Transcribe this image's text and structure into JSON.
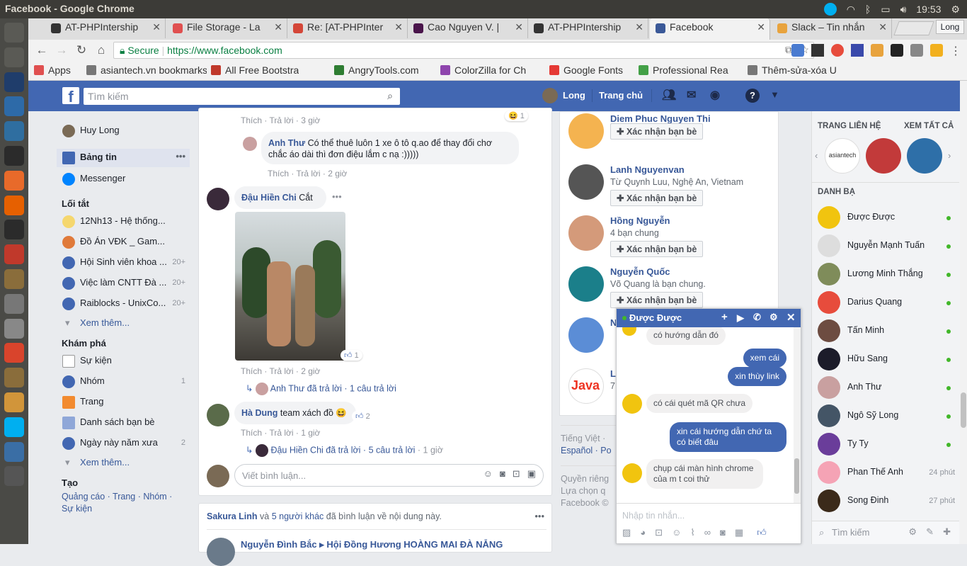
{
  "os": {
    "window_title": "Facebook - Google Chrome",
    "clock": "19:53",
    "user": "Long"
  },
  "launcher": [
    "dash-icon",
    "camera-icon",
    "photoshop-icon",
    "text-editor-icon",
    "network-icon",
    "terminal-icon",
    "software-center-icon",
    "firefox-icon",
    "amazon-icon",
    "settings-icon",
    "archive-icon",
    "disk-icon",
    "disk2-icon",
    "chrome-icon",
    "files-icon",
    "sublime-icon",
    "skype-icon",
    "monitor-icon",
    "trash-icon"
  ],
  "tabs": [
    {
      "label": "AT-PHPIntership",
      "color": "#333"
    },
    {
      "label": "File Storage - La",
      "color": "#e05050"
    },
    {
      "label": "Re: [AT-PHPInter",
      "color": "#d44638"
    },
    {
      "label": "Cao Nguyen V. |",
      "color": "#4a154b"
    },
    {
      "label": "AT-PHPIntership",
      "color": "#333"
    },
    {
      "label": "Facebook",
      "color": "#3b5998"
    },
    {
      "label": "Slack – Tin nhắn",
      "color": "#e8a33d"
    }
  ],
  "omnibar": {
    "secure": "Secure",
    "url": "https://www.facebook.com"
  },
  "bookmarks": [
    {
      "label": "Apps",
      "color": "#e05050"
    },
    {
      "label": "asiantech.vn bookmarks",
      "color": "#777"
    },
    {
      "label": "All Free Bootstra",
      "color": "#c0392b"
    },
    {
      "label": "AngryTools.com",
      "color": "#2e7d32"
    },
    {
      "label": "ColorZilla for Ch",
      "color": "#8e44ad"
    },
    {
      "label": "Google Fonts",
      "color": "#e53935"
    },
    {
      "label": "Professional Rea",
      "color": "#43a047"
    },
    {
      "label": "Thêm-sửa-xóa U",
      "color": "#777"
    }
  ],
  "fb": {
    "search_placeholder": "Tìm kiếm",
    "user": "Long",
    "home": "Trang chủ"
  },
  "leftnav": {
    "profile": "Huy Long",
    "newsfeed": "Bảng tin",
    "messenger": "Messenger",
    "shortcuts_title": "Lối tắt",
    "shortcuts": [
      {
        "label": "12Nh13 - Hệ thống...",
        "count": ""
      },
      {
        "label": "Đồ Án VĐK _ Gam...",
        "count": ""
      },
      {
        "label": "Hội Sinh viên khoa ...",
        "count": "20+"
      },
      {
        "label": "Việc làm CNTT Đà ...",
        "count": "20+"
      },
      {
        "label": "Raiblocks - UnixCo...",
        "count": "20+"
      }
    ],
    "see_more": "Xem thêm...",
    "explore_title": "Khám phá",
    "explore": [
      {
        "label": "Sự kiện",
        "count": ""
      },
      {
        "label": "Nhóm",
        "count": "1"
      },
      {
        "label": "Trang",
        "count": ""
      },
      {
        "label": "Danh sách bạn bè",
        "count": ""
      },
      {
        "label": "Ngày này năm xưa",
        "count": "2"
      }
    ],
    "see_more2": "Xem thêm...",
    "create_title": "Tạo",
    "create_links": "Quảng cáo · Trang · Nhóm ·",
    "create_links2": "Sự kiện"
  },
  "feed": {
    "c1_actions": "Thích · Trả lời · 3 giờ",
    "c1_react": "1",
    "c2_name": "Anh Thư",
    "c2_text": "Có thể thuê luôn 1 xe ô tô q.ao để thay đổi chơ chắc áo dài thì đơn điệu lắm c nạ :)))))",
    "c2_actions": "Thích · Trả lời · 2 giờ",
    "c3_name": "Đậu Hiền Chi",
    "c3_text": "Cắt",
    "c3_react": "1",
    "c3_actions": "Thích · Trả lời · 2 giờ",
    "c3_replies": "Anh Thư đã trả lời · 1 câu trả lời",
    "c4_name": "Hà Dung",
    "c4_text": "team xách đồ",
    "c4_react": "2",
    "c4_actions": "Thích · Trả lời · 1 giờ",
    "c4_replies": "Đậu Hiền Chi đã trả lời · 5 câu trả lời",
    "c4_replies_time": "· 1 giờ",
    "comment_placeholder": "Viết bình luận...",
    "next_post_a": "Sakura Linh",
    "next_post_b": "và",
    "next_post_c": "5 người khác",
    "next_post_d": "đã bình luận về nội dung này.",
    "next_post_e": "Nguyễn Đình Bắc ▸ Hội Đồng Hương HOÀNG MAI ĐÀ NẴNG"
  },
  "suggest": [
    {
      "name": "Diem Phuc Nguyen Thi",
      "sub": "",
      "btn": "Xác nhận bạn bè",
      "color": "#f4b350"
    },
    {
      "name": "Lanh Nguyenvan",
      "sub": "Từ Quynh Luu, Nghệ An, Vietnam",
      "btn": "Xác nhận bạn bè",
      "color": "#555"
    },
    {
      "name": "Hồng Nguyễn",
      "sub": "4 bạn chung",
      "btn": "Xác nhận bạn bè",
      "color": "#d49a7a"
    },
    {
      "name": "Nguyễn Quốc",
      "sub": "Võ Quang là bạn chung.",
      "btn": "Xác nhận bạn bè",
      "color": "#1b7f8a"
    },
    {
      "name": "N",
      "sub": "",
      "btn": "",
      "color": "#5b8dd6"
    },
    {
      "name": "La",
      "sub": "7",
      "btn": "",
      "color": "#fff"
    }
  ],
  "footer": {
    "lang": "Tiếng Việt ·",
    "lang2": "Español · Po",
    "l1": "Quyền riêng",
    "l2": "Lựa chọn q",
    "l3": "Facebook ©"
  },
  "rightbar": {
    "contacts_title": "TRANG LIÊN HỆ",
    "see_all": "XEM TẤT CẢ",
    "friends_title": "DANH BẠ",
    "friends": [
      {
        "name": "Được Được",
        "status": "online",
        "time": "",
        "color": "#f1c40f"
      },
      {
        "name": "Nguyễn Mạnh Tuấn",
        "status": "online",
        "time": "",
        "color": "#ddd"
      },
      {
        "name": "Lương Minh Thắng",
        "status": "online",
        "time": "",
        "color": "#7f8c5a"
      },
      {
        "name": "Darius Quang",
        "status": "online",
        "time": "",
        "color": "#e74c3c"
      },
      {
        "name": "Tấn Minh",
        "status": "online",
        "time": "",
        "color": "#6d4c41"
      },
      {
        "name": "Hữu Sang",
        "status": "online",
        "time": "",
        "color": "#1c1c2a"
      },
      {
        "name": "Anh Thư",
        "status": "online",
        "time": "",
        "color": "#c9a0a0"
      },
      {
        "name": "Ngô Sỹ Long",
        "status": "online",
        "time": "",
        "color": "#445566"
      },
      {
        "name": "Ty Ty",
        "status": "online",
        "time": "",
        "color": "#6a3d9a"
      },
      {
        "name": "Phan Thế Anh",
        "status": "away",
        "time": "24 phút",
        "color": "#f5a3b5"
      },
      {
        "name": "Song Đinh",
        "status": "away",
        "time": "27 phút",
        "color": "#3b2a1a"
      }
    ],
    "search_placeholder": "Tìm kiếm"
  },
  "chat": {
    "title": "Được Được",
    "messages": [
      {
        "from": "them",
        "text": "có hướng dẫn đó"
      },
      {
        "from": "me",
        "text": "xem cái"
      },
      {
        "from": "me",
        "text": "xin thùy link"
      },
      {
        "from": "them",
        "text": "có cái quét mã QR chưa"
      },
      {
        "from": "me",
        "text": "xin cái hướng dẫn chứ ta có biết đâu"
      },
      {
        "from": "them",
        "text": "chụp cái màn hình chrome của m t coi thử"
      }
    ],
    "input_placeholder": "Nhập tin nhắn..."
  }
}
